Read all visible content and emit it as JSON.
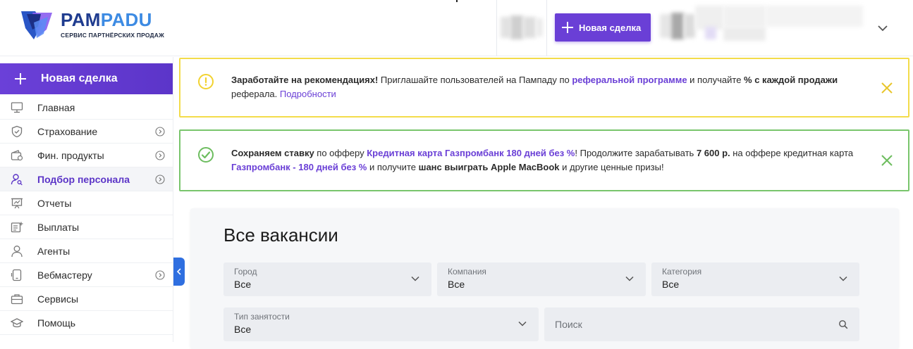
{
  "brand": {
    "logo_part1": "PAM",
    "logo_part2": "PADU",
    "tagline": "СЕРВИС ПАРТНЁРСКИХ ПРОДАЖ"
  },
  "header": {
    "new_deal_label": "Новая сделка",
    "menu_icon": "chevron-down-icon"
  },
  "sidebar": {
    "new_deal_label": "Новая сделка",
    "items": [
      {
        "label": "Главная",
        "icon": "monitor-icon",
        "has_arrow": false,
        "active": false
      },
      {
        "label": "Страхование",
        "icon": "shield-check-icon",
        "has_arrow": true,
        "active": false
      },
      {
        "label": "Фин. продукты",
        "icon": "wallet-icon",
        "has_arrow": true,
        "active": false
      },
      {
        "label": "Подбор персонала",
        "icon": "user-search-icon",
        "has_arrow": true,
        "active": true
      },
      {
        "label": "Отчеты",
        "icon": "presentation-chart-icon",
        "has_arrow": false,
        "active": false
      },
      {
        "label": "Выплаты",
        "icon": "payout-list-icon",
        "has_arrow": false,
        "active": false
      },
      {
        "label": "Агенты",
        "icon": "user-icon",
        "has_arrow": false,
        "active": false
      },
      {
        "label": "Вебмастеру",
        "icon": "mobile-icon",
        "has_arrow": true,
        "active": false
      },
      {
        "label": "Сервисы",
        "icon": "briefcase-icon",
        "has_arrow": false,
        "active": false
      },
      {
        "label": "Помощь",
        "icon": "graduation-cap-icon",
        "has_arrow": false,
        "active": false
      }
    ]
  },
  "banners": {
    "referral": {
      "title": "Заработайте на рекомендациях!",
      "text1": " Приглашайте пользователей на Пампаду по ",
      "link1": "реферальной программе",
      "text2": " и получайте ",
      "bold2": "% с каждой продажи",
      "text3": " реферала. ",
      "link2": "Подробности"
    },
    "rate": {
      "title": "Сохраняем ставку",
      "text1": " по офферу ",
      "link1": "Кредитная карта Газпромбанк 180 дней без %",
      "text2": "! Продолжите зарабатывать ",
      "bold2": "7 600 р.",
      "text3": " на оффере кредитная карта  ",
      "link2": "Газпромбанк - 180 дней без %",
      "text4": " и получите ",
      "bold4": "шанс выиграть Apple MacBook",
      "text5": " и другие ценные призы!"
    }
  },
  "vacancies": {
    "title": "Все вакансии",
    "filters": {
      "city": {
        "label": "Город",
        "value": "Все"
      },
      "company": {
        "label": "Компания",
        "value": "Все"
      },
      "category": {
        "label": "Категория",
        "value": "Все"
      },
      "employment": {
        "label": "Тип занятости",
        "value": "Все"
      },
      "search": {
        "placeholder": "Поиск"
      }
    }
  },
  "colors": {
    "accent": "#6a3fd6",
    "warning_border": "#f3dc4b",
    "success_border": "#79c56c",
    "collapse_tab": "#2f6fe0"
  }
}
